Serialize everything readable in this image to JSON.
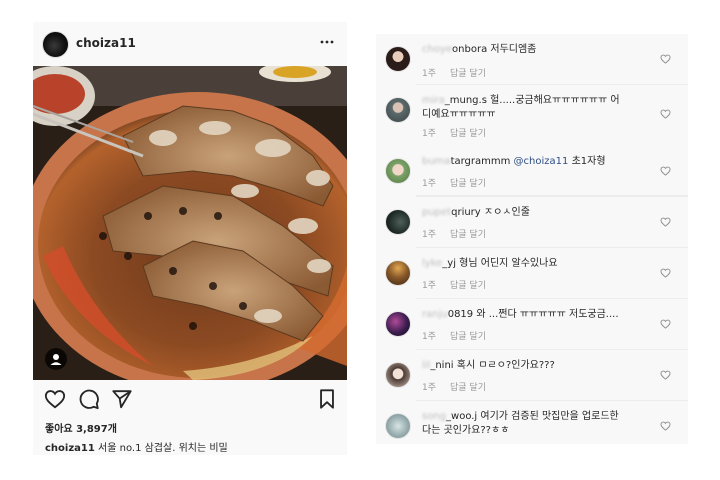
{
  "post": {
    "username": "choiza11",
    "likes": "좋아요 3,897개",
    "caption_user": "choiza11",
    "caption_text": "서울 no.1 삼겹살. 위치는 비밀"
  },
  "comments": [
    {
      "user_hidden": "choye",
      "user_visible": "onbora",
      "text": " 저두디엠좀",
      "text2": "",
      "time": "1주",
      "reply": "답글 달기",
      "avatar_color": "#2a1c18"
    },
    {
      "user_hidden": "mira",
      "user_visible": "_mung.s",
      "text": " 헐.....궁금해요ㅠㅠㅠㅠㅠㅠ 어",
      "text2": "디예요ㅠㅠㅠㅠㅠ",
      "time": "1주",
      "reply": "답글 달기",
      "avatar_color": "#5b6a6c"
    },
    {
      "user_hidden": "buma",
      "user_visible": "targrammm",
      "mention": "@choiza11",
      "text": " 초1자형",
      "text2": "",
      "time": "1주",
      "reply": "답글 달기",
      "avatar_color": "#7da36b"
    },
    {
      "user_hidden": "pupet",
      "user_visible": "qriury",
      "text": " ㅈㅇㅅ인줄",
      "text2": "",
      "time": "1주",
      "reply": "답글 달기",
      "avatar_color": "#1f2b26"
    },
    {
      "user_hidden": "lyke",
      "user_visible": "_yj",
      "text": " 형님 어딘지 알수있나요",
      "text2": "",
      "time": "1주",
      "reply": "답글 달기",
      "avatar_color": "#8a5a2b"
    },
    {
      "user_hidden": "ranju",
      "user_visible": "0819",
      "text": " 와 ...쩐다 ㅠㅠㅠㅠㅠ 저도궁금....",
      "text2": "",
      "time": "1주",
      "reply": "답글 달기",
      "avatar_color": "#3b1d4e"
    },
    {
      "user_hidden": "lil",
      "user_visible": "_nini",
      "text": " 혹시 ㅁㄹㅇ?인가요???",
      "text2": "",
      "time": "1주",
      "reply": "답글 달기",
      "avatar_color": "#c9b9ab"
    },
    {
      "user_hidden": "song",
      "user_visible": "_woo.j",
      "text": " 여기가 검증된 맛집만을 업로드한",
      "text2": "다는 곳인가요??ㅎㅎ",
      "time": "",
      "reply": "",
      "avatar_color": "#9fb3b5"
    }
  ]
}
